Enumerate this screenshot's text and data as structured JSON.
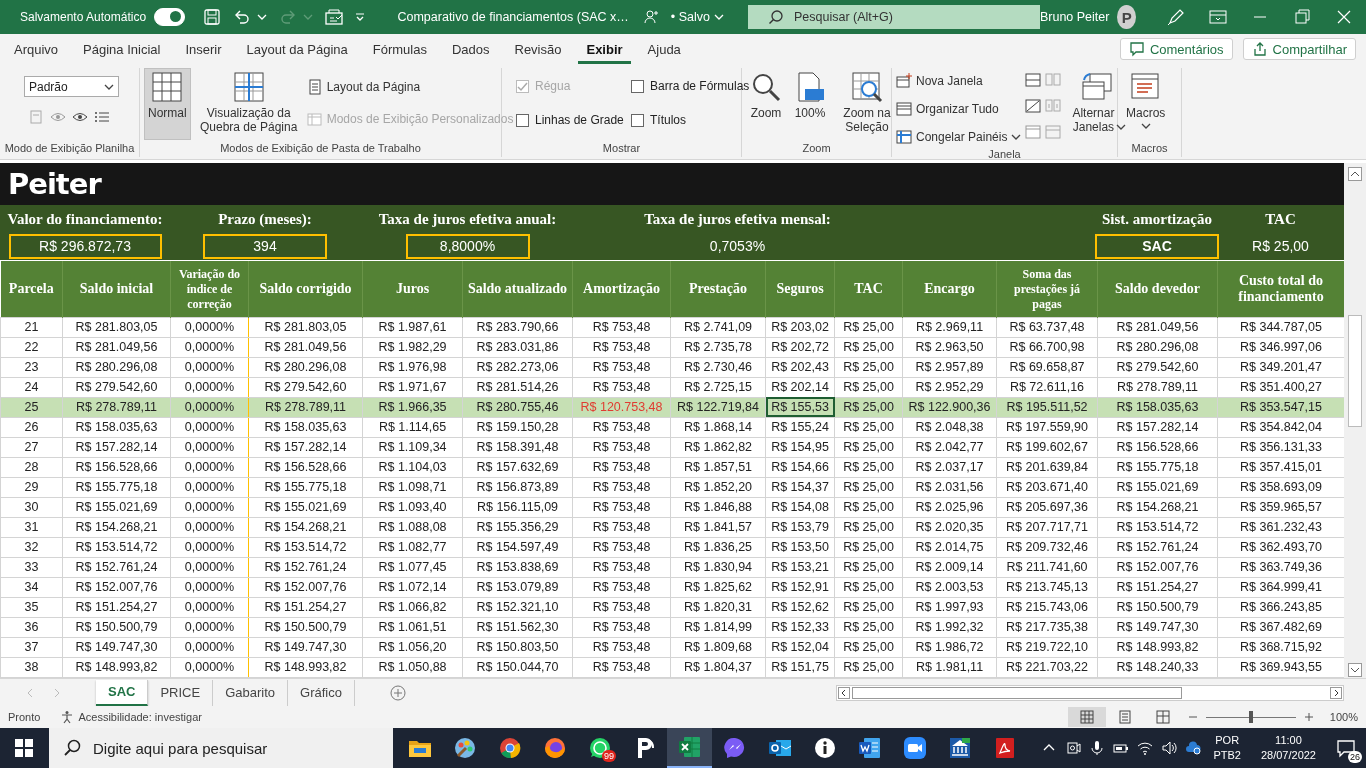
{
  "title_bar": {
    "autosave_label": "Salvamento Automático",
    "autosave_on": true,
    "document_title": "Comparativo de financiamentos (SAC x…",
    "save_status": "• Salvo",
    "search_placeholder": "Pesquisar (Alt+G)",
    "user_name": "Bruno Peiter",
    "avatar_initial": "P"
  },
  "menu": {
    "tabs": [
      {
        "label": "Arquivo",
        "selected": false
      },
      {
        "label": "Página Inicial",
        "selected": false
      },
      {
        "label": "Inserir",
        "selected": false
      },
      {
        "label": "Layout da Página",
        "selected": false
      },
      {
        "label": "Fórmulas",
        "selected": false
      },
      {
        "label": "Dados",
        "selected": false
      },
      {
        "label": "Revisão",
        "selected": false
      },
      {
        "label": "Exibir",
        "selected": true
      },
      {
        "label": "Ajuda",
        "selected": false
      }
    ],
    "actions": [
      "Comentários",
      "Compartilhar"
    ]
  },
  "ribbon": {
    "groups": [
      {
        "label": "Modo de Exibição Planilha",
        "columns": [
          [
            {
              "kind": "dropdown",
              "label": "Padrão"
            },
            {
              "kind": "icon-strip"
            }
          ]
        ]
      },
      {
        "label": "Modos de Exibição de Pasta de Trabalho",
        "columns": [
          [
            {
              "kind": "big",
              "label": "Normal",
              "selected": true,
              "dropdown": false
            }
          ],
          [
            {
              "kind": "big",
              "label": "Visualização da Quebra de Página",
              "selected": false,
              "dropdown": false
            }
          ],
          [
            {
              "kind": "small",
              "label": "Layout da Página",
              "disabled": false,
              "dropdown": false
            },
            {
              "kind": "small",
              "label": "Modos de Exibição Personalizados",
              "disabled": true,
              "dropdown": false
            }
          ]
        ]
      },
      {
        "label": "Mostrar",
        "columns": [
          [
            {
              "kind": "check",
              "label": "Régua",
              "checked": true,
              "disabled": true
            },
            {
              "kind": "check",
              "label": "Linhas de Grade",
              "checked": false,
              "disabled": false
            }
          ],
          [
            {
              "kind": "check",
              "label": "Barra de Fórmulas",
              "checked": false,
              "disabled": false
            },
            {
              "kind": "check",
              "label": "Títulos",
              "checked": false,
              "disabled": false
            }
          ]
        ]
      },
      {
        "label": "Zoom",
        "columns": [
          [
            {
              "kind": "big",
              "label": "Zoom",
              "selected": false,
              "dropdown": false
            }
          ],
          [
            {
              "kind": "big",
              "label": "100%",
              "selected": false,
              "dropdown": false
            }
          ],
          [
            {
              "kind": "big",
              "label": "Zoom na Seleção",
              "selected": false,
              "dropdown": false
            }
          ]
        ]
      },
      {
        "label": "Janela",
        "columns": [
          [
            {
              "kind": "small",
              "label": "Nova Janela",
              "disabled": false,
              "dropdown": false
            },
            {
              "kind": "small",
              "label": "Organizar Tudo",
              "disabled": false,
              "dropdown": false
            },
            {
              "kind": "small",
              "label": "Congelar Painéis",
              "disabled": false,
              "dropdown": true
            }
          ],
          [
            {
              "kind": "icon-strip"
            }
          ],
          [
            {
              "kind": "icon-strip"
            }
          ],
          [
            {
              "kind": "big",
              "label": "Alternar Janelas",
              "selected": false,
              "dropdown": true
            }
          ]
        ]
      },
      {
        "label": "Macros",
        "columns": [
          [
            {
              "kind": "big",
              "label": "Macros",
              "selected": false,
              "dropdown": true
            }
          ]
        ]
      }
    ]
  },
  "sheet": {
    "logo": "Peiter",
    "parameters": [
      {
        "label": "Valor do financiamento:",
        "value": "R$ 296.872,73",
        "boxed": true,
        "strong": false
      },
      {
        "label": "Prazo (meses):",
        "value": "394",
        "boxed": true,
        "strong": false
      },
      {
        "label": "Taxa de juros efetiva anual:",
        "value": "8,8000%",
        "boxed": true,
        "strong": false
      },
      {
        "label": "Taxa de juros efetiva mensal:",
        "value": "0,7053%",
        "boxed": false,
        "strong": false
      },
      {
        "label": "Sist. amortização",
        "value": "SAC",
        "boxed": true,
        "strong": true
      },
      {
        "label": "TAC",
        "value": "R$ 25,00",
        "boxed": false,
        "strong": false
      }
    ],
    "table": {
      "columns": [
        "Parcela",
        "Saldo inicial",
        "Variação do índice de correção",
        "Saldo corrigido",
        "Juros",
        "Saldo atualizado",
        "Amortização",
        "Prestação",
        "Seguros",
        "TAC",
        "Encargo",
        "Soma das prestações já pagas",
        "Saldo devedor",
        "Custo total do financiamento"
      ],
      "rows": [
        {
          "selected": false,
          "alert": false,
          "active": false,
          "cells": [
            "21",
            "R$ 281.803,05",
            "0,0000%",
            "R$ 281.803,05",
            "R$ 1.987,61",
            "R$ 283.790,66",
            "R$ 753,48",
            "R$ 2.741,09",
            "R$ 203,02",
            "R$ 25,00",
            "R$ 2.969,11",
            "R$ 63.737,48",
            "R$ 281.049,56",
            "R$ 344.787,05"
          ]
        },
        {
          "selected": false,
          "alert": false,
          "active": false,
          "cells": [
            "22",
            "R$ 281.049,56",
            "0,0000%",
            "R$ 281.049,56",
            "R$ 1.982,29",
            "R$ 283.031,86",
            "R$ 753,48",
            "R$ 2.735,78",
            "R$ 202,72",
            "R$ 25,00",
            "R$ 2.963,50",
            "R$ 66.700,98",
            "R$ 280.296,08",
            "R$ 346.997,06"
          ]
        },
        {
          "selected": false,
          "alert": false,
          "active": false,
          "cells": [
            "23",
            "R$ 280.296,08",
            "0,0000%",
            "R$ 280.296,08",
            "R$ 1.976,98",
            "R$ 282.273,06",
            "R$ 753,48",
            "R$ 2.730,46",
            "R$ 202,43",
            "R$ 25,00",
            "R$ 2.957,89",
            "R$ 69.658,87",
            "R$ 279.542,60",
            "R$ 349.201,47"
          ]
        },
        {
          "selected": false,
          "alert": false,
          "active": false,
          "cells": [
            "24",
            "R$ 279.542,60",
            "0,0000%",
            "R$ 279.542,60",
            "R$ 1.971,67",
            "R$ 281.514,26",
            "R$ 753,48",
            "R$ 2.725,15",
            "R$ 202,14",
            "R$ 25,00",
            "R$ 2.952,29",
            "R$ 72.611,16",
            "R$ 278.789,11",
            "R$ 351.400,27"
          ]
        },
        {
          "selected": true,
          "alert": true,
          "active": true,
          "cells": [
            "25",
            "R$ 278.789,11",
            "0,0000%",
            "R$ 278.789,11",
            "R$ 1.966,35",
            "R$ 280.755,46",
            "R$ 120.753,48",
            "R$ 122.719,84",
            "R$ 155,53",
            "R$ 25,00",
            "R$ 122.900,36",
            "R$ 195.511,52",
            "R$ 158.035,63",
            "R$ 353.547,15"
          ]
        },
        {
          "selected": false,
          "alert": false,
          "active": false,
          "cells": [
            "26",
            "R$ 158.035,63",
            "0,0000%",
            "R$ 158.035,63",
            "R$ 1.114,65",
            "R$ 159.150,28",
            "R$ 753,48",
            "R$ 1.868,14",
            "R$ 155,24",
            "R$ 25,00",
            "R$ 2.048,38",
            "R$ 197.559,90",
            "R$ 157.282,14",
            "R$ 354.842,04"
          ]
        },
        {
          "selected": false,
          "alert": false,
          "active": false,
          "cells": [
            "27",
            "R$ 157.282,14",
            "0,0000%",
            "R$ 157.282,14",
            "R$ 1.109,34",
            "R$ 158.391,48",
            "R$ 753,48",
            "R$ 1.862,82",
            "R$ 154,95",
            "R$ 25,00",
            "R$ 2.042,77",
            "R$ 199.602,67",
            "R$ 156.528,66",
            "R$ 356.131,33"
          ]
        },
        {
          "selected": false,
          "alert": false,
          "active": false,
          "cells": [
            "28",
            "R$ 156.528,66",
            "0,0000%",
            "R$ 156.528,66",
            "R$ 1.104,03",
            "R$ 157.632,69",
            "R$ 753,48",
            "R$ 1.857,51",
            "R$ 154,66",
            "R$ 25,00",
            "R$ 2.037,17",
            "R$ 201.639,84",
            "R$ 155.775,18",
            "R$ 357.415,01"
          ]
        },
        {
          "selected": false,
          "alert": false,
          "active": false,
          "cells": [
            "29",
            "R$ 155.775,18",
            "0,0000%",
            "R$ 155.775,18",
            "R$ 1.098,71",
            "R$ 156.873,89",
            "R$ 753,48",
            "R$ 1.852,20",
            "R$ 154,37",
            "R$ 25,00",
            "R$ 2.031,56",
            "R$ 203.671,40",
            "R$ 155.021,69",
            "R$ 358.693,09"
          ]
        },
        {
          "selected": false,
          "alert": false,
          "active": false,
          "cells": [
            "30",
            "R$ 155.021,69",
            "0,0000%",
            "R$ 155.021,69",
            "R$ 1.093,40",
            "R$ 156.115,09",
            "R$ 753,48",
            "R$ 1.846,88",
            "R$ 154,08",
            "R$ 25,00",
            "R$ 2.025,96",
            "R$ 205.697,36",
            "R$ 154.268,21",
            "R$ 359.965,57"
          ]
        },
        {
          "selected": false,
          "alert": false,
          "active": false,
          "cells": [
            "31",
            "R$ 154.268,21",
            "0,0000%",
            "R$ 154.268,21",
            "R$ 1.088,08",
            "R$ 155.356,29",
            "R$ 753,48",
            "R$ 1.841,57",
            "R$ 153,79",
            "R$ 25,00",
            "R$ 2.020,35",
            "R$ 207.717,71",
            "R$ 153.514,72",
            "R$ 361.232,43"
          ]
        },
        {
          "selected": false,
          "alert": false,
          "active": false,
          "cells": [
            "32",
            "R$ 153.514,72",
            "0,0000%",
            "R$ 153.514,72",
            "R$ 1.082,77",
            "R$ 154.597,49",
            "R$ 753,48",
            "R$ 1.836,25",
            "R$ 153,50",
            "R$ 25,00",
            "R$ 2.014,75",
            "R$ 209.732,46",
            "R$ 152.761,24",
            "R$ 362.493,70"
          ]
        },
        {
          "selected": false,
          "alert": false,
          "active": false,
          "cells": [
            "33",
            "R$ 152.761,24",
            "0,0000%",
            "R$ 152.761,24",
            "R$ 1.077,45",
            "R$ 153.838,69",
            "R$ 753,48",
            "R$ 1.830,94",
            "R$ 153,21",
            "R$ 25,00",
            "R$ 2.009,14",
            "R$ 211.741,60",
            "R$ 152.007,76",
            "R$ 363.749,36"
          ]
        },
        {
          "selected": false,
          "alert": false,
          "active": false,
          "cells": [
            "34",
            "R$ 152.007,76",
            "0,0000%",
            "R$ 152.007,76",
            "R$ 1.072,14",
            "R$ 153.079,89",
            "R$ 753,48",
            "R$ 1.825,62",
            "R$ 152,91",
            "R$ 25,00",
            "R$ 2.003,53",
            "R$ 213.745,13",
            "R$ 151.254,27",
            "R$ 364.999,41"
          ]
        },
        {
          "selected": false,
          "alert": false,
          "active": false,
          "cells": [
            "35",
            "R$ 151.254,27",
            "0,0000%",
            "R$ 151.254,27",
            "R$ 1.066,82",
            "R$ 152.321,10",
            "R$ 753,48",
            "R$ 1.820,31",
            "R$ 152,62",
            "R$ 25,00",
            "R$ 1.997,93",
            "R$ 215.743,06",
            "R$ 150.500,79",
            "R$ 366.243,85"
          ]
        },
        {
          "selected": false,
          "alert": false,
          "active": false,
          "cells": [
            "36",
            "R$ 150.500,79",
            "0,0000%",
            "R$ 150.500,79",
            "R$ 1.061,51",
            "R$ 151.562,30",
            "R$ 753,48",
            "R$ 1.814,99",
            "R$ 152,33",
            "R$ 25,00",
            "R$ 1.992,32",
            "R$ 217.735,38",
            "R$ 149.747,30",
            "R$ 367.482,69"
          ]
        },
        {
          "selected": false,
          "alert": false,
          "active": false,
          "cells": [
            "37",
            "R$ 149.747,30",
            "0,0000%",
            "R$ 149.747,30",
            "R$ 1.056,20",
            "R$ 150.803,50",
            "R$ 753,48",
            "R$ 1.809,68",
            "R$ 152,04",
            "R$ 25,00",
            "R$ 1.986,72",
            "R$ 219.722,10",
            "R$ 148.993,82",
            "R$ 368.715,92"
          ]
        },
        {
          "selected": false,
          "alert": false,
          "active": false,
          "cells": [
            "38",
            "R$ 148.993,82",
            "0,0000%",
            "R$ 148.993,82",
            "R$ 1.050,88",
            "R$ 150.044,70",
            "R$ 753,48",
            "R$ 1.804,37",
            "R$ 151,75",
            "R$ 25,00",
            "R$ 1.981,11",
            "R$ 221.703,22",
            "R$ 148.240,33",
            "R$ 369.943,55"
          ]
        }
      ]
    }
  },
  "sheet_tabs": [
    {
      "label": "SAC",
      "selected": true
    },
    {
      "label": "PRICE",
      "selected": false
    },
    {
      "label": "Gabarito",
      "selected": false
    },
    {
      "label": "Gráfico",
      "selected": false
    }
  ],
  "status_bar": {
    "status": "Pronto",
    "accessibility": "Acessibilidade: investigar",
    "views": [
      {
        "selected": true
      },
      {
        "selected": false
      },
      {
        "selected": false
      }
    ],
    "zoom_slider": {
      "level": 0.5
    },
    "zoom": "100%"
  },
  "taskbar": {
    "search_placeholder": "Digite aqui para pesquisar",
    "apps": [
      {
        "active": false
      },
      {
        "active": false
      },
      {
        "active": false
      },
      {
        "active": false
      },
      {
        "active": false,
        "badge": "99"
      },
      {
        "active": false
      },
      {
        "active": true
      },
      {
        "active": false
      },
      {
        "active": false
      },
      {
        "active": false
      },
      {
        "active": false
      },
      {
        "active": false
      },
      {
        "active": false
      },
      {
        "active": false
      }
    ],
    "language": "POR",
    "layout": "PTB2",
    "time": "11:00",
    "date": "28/07/2022",
    "notifications": "26"
  }
}
